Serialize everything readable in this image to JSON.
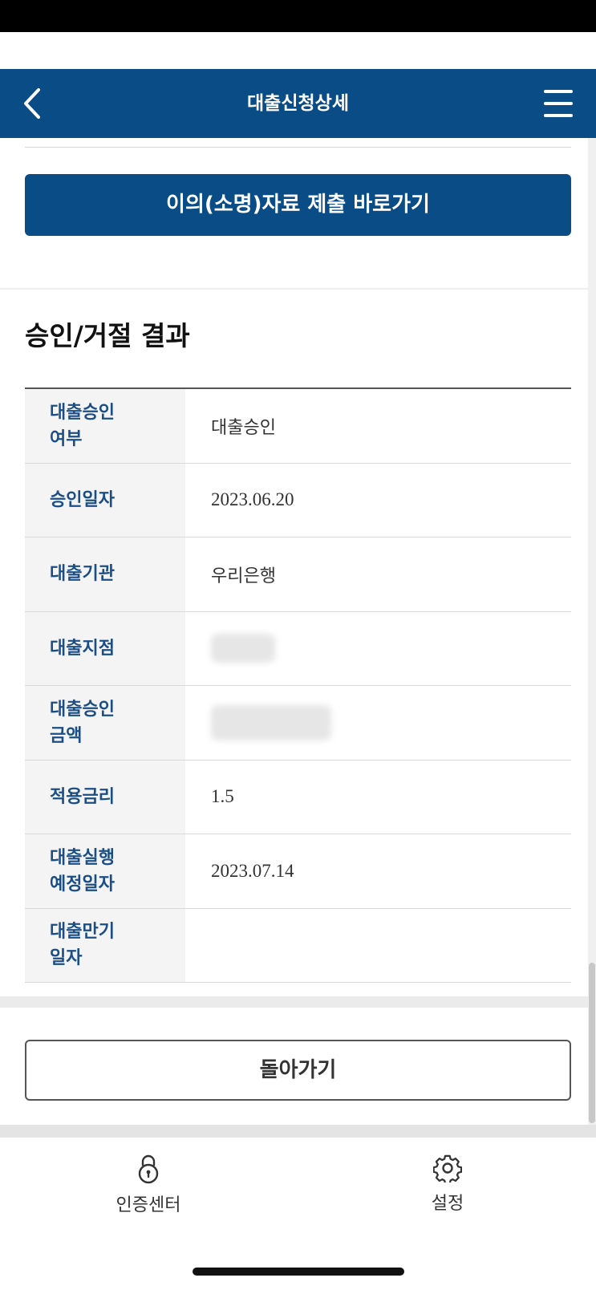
{
  "header": {
    "title": "대출신청상세"
  },
  "objection_button": {
    "label": "이의(소명)자료 제출  바로가기"
  },
  "section": {
    "title": "승인/거절 결과"
  },
  "result_rows": [
    {
      "label": "대출승인\n여부",
      "value": "대출승인"
    },
    {
      "label": "승인일자",
      "value": "2023.06.20"
    },
    {
      "label": "대출기관",
      "value": "우리은행"
    },
    {
      "label": "대출지점",
      "value": ""
    },
    {
      "label": "대출승인\n금액",
      "value": ""
    },
    {
      "label": "적용금리",
      "value": "1.5"
    },
    {
      "label": "대출실행\n예정일자",
      "value": "2023.07.14"
    },
    {
      "label": "대출만기\n일자",
      "value": ""
    }
  ],
  "back_button": {
    "label": "돌아가기"
  },
  "tabbar": {
    "cert_label": "인증센터",
    "settings_label": "설정"
  },
  "colors": {
    "brand": "#0a4c86",
    "label_text": "#1c4e86"
  },
  "icons": {
    "back": "chevron-left-icon",
    "menu": "hamburger-menu-icon",
    "cert": "lock-icon",
    "settings": "gear-icon"
  }
}
